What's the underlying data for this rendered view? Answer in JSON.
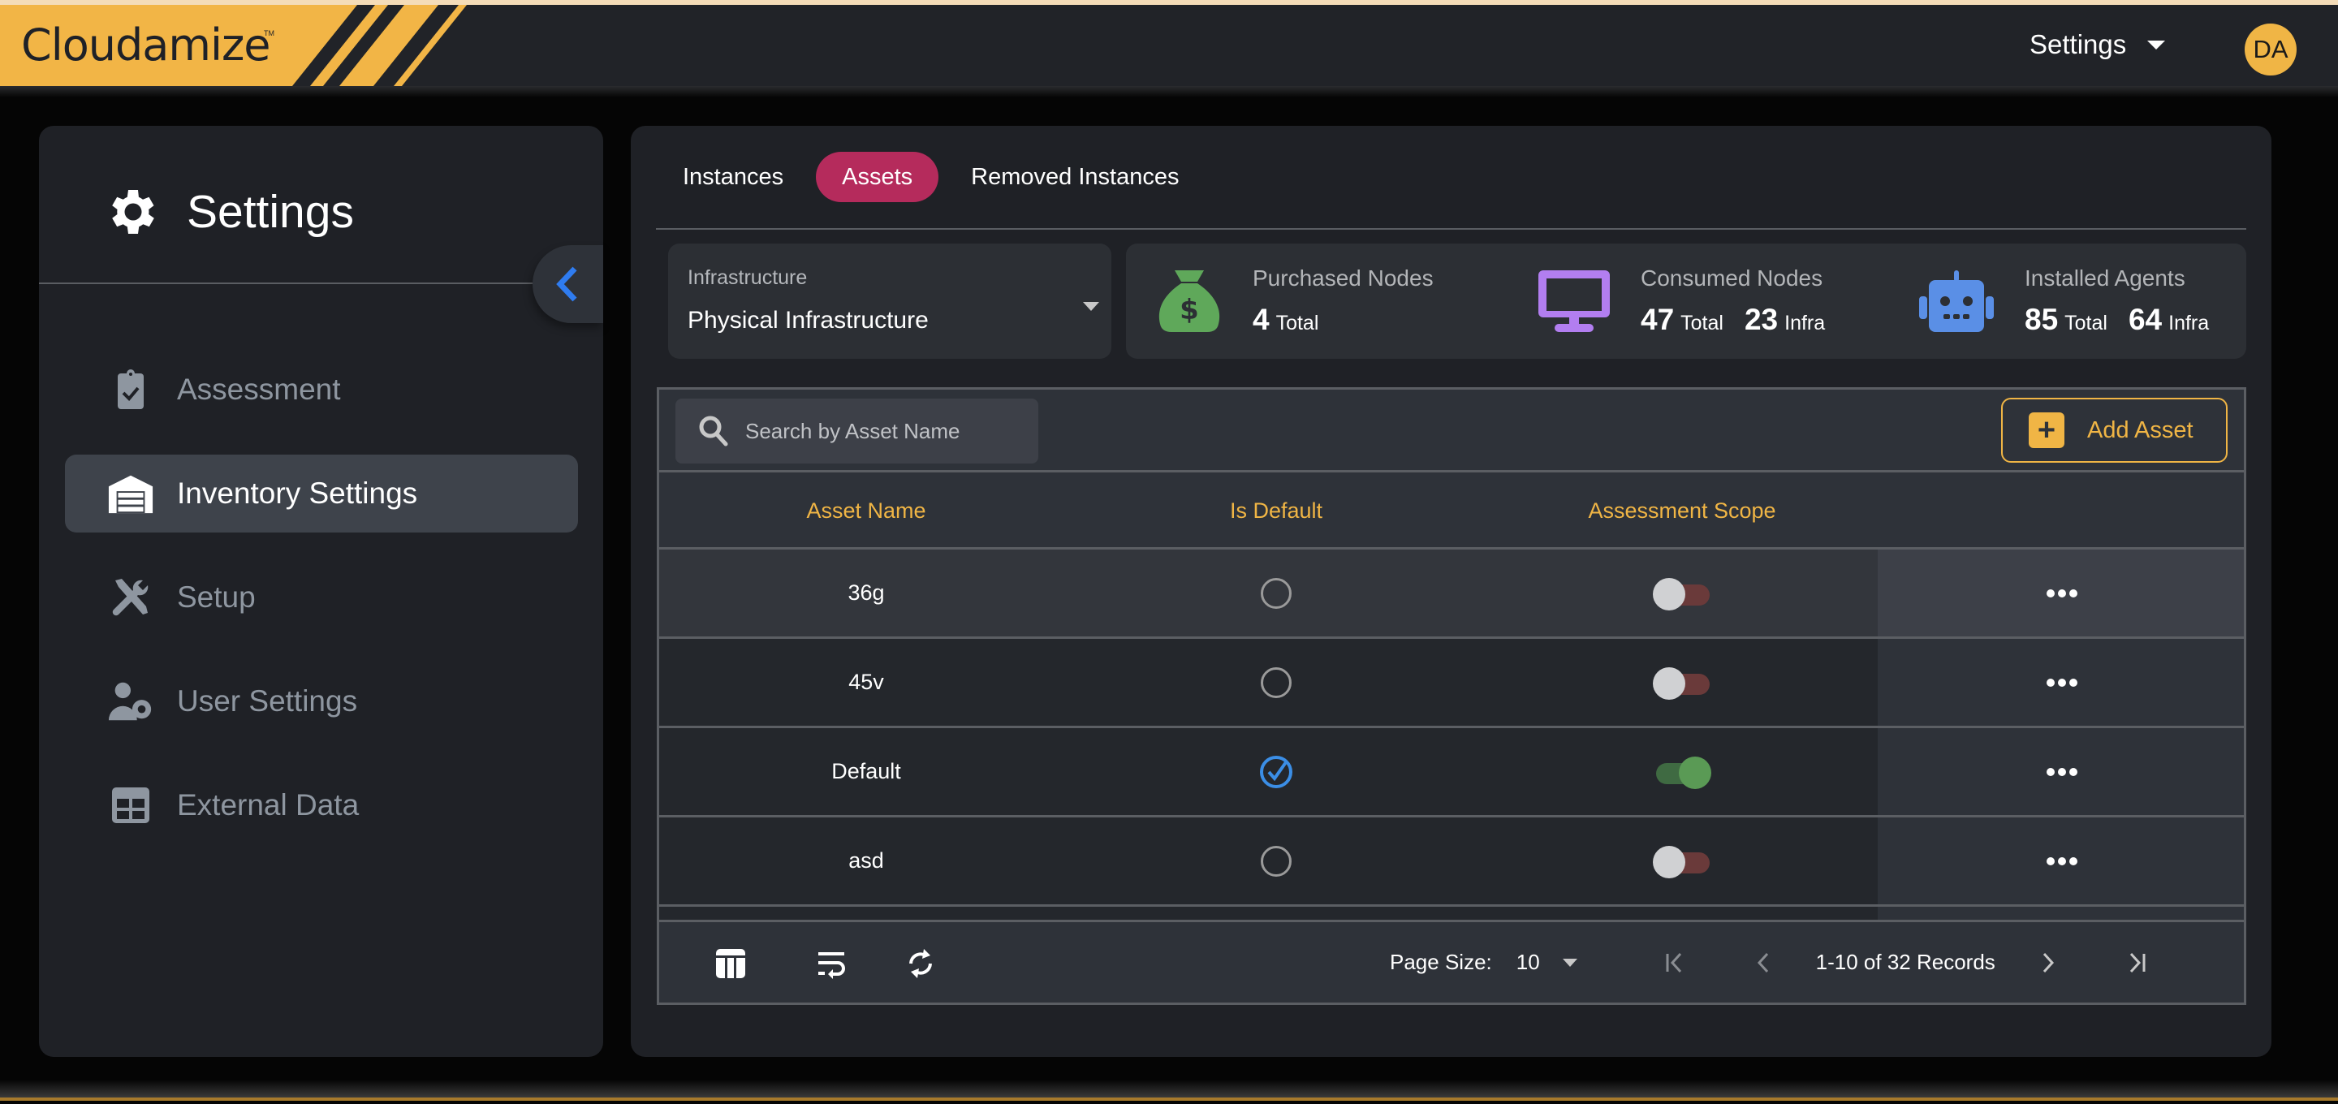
{
  "header": {
    "logo": "Cloudamize",
    "logo_tm": "TM",
    "settings_menu": "Settings",
    "avatar_initials": "DA",
    "brand_color": "#f0b545"
  },
  "sidebar": {
    "title": "Settings",
    "items": [
      {
        "label": "Assessment",
        "icon": "clipboard-check-icon",
        "active": false
      },
      {
        "label": "Inventory Settings",
        "icon": "warehouse-icon",
        "active": true
      },
      {
        "label": "Setup",
        "icon": "tools-icon",
        "active": false
      },
      {
        "label": "User Settings",
        "icon": "user-gear-icon",
        "active": false
      },
      {
        "label": "External Data",
        "icon": "table-icon",
        "active": false
      }
    ]
  },
  "main": {
    "tabs": [
      {
        "label": "Instances",
        "active": false
      },
      {
        "label": "Assets",
        "active": true
      },
      {
        "label": "Removed Instances",
        "active": false
      }
    ],
    "infrastructure": {
      "label": "Infrastructure",
      "value": "Physical Infrastructure"
    },
    "stats": [
      {
        "title": "Purchased Nodes",
        "icon": "money-bag-icon",
        "color": "#5fa85a",
        "values": [
          {
            "num": "4",
            "unit": "Total"
          }
        ]
      },
      {
        "title": "Consumed Nodes",
        "icon": "monitor-icon",
        "color": "#b27ef0",
        "values": [
          {
            "num": "47",
            "unit": "Total"
          },
          {
            "num": "23",
            "unit": "Infra"
          }
        ]
      },
      {
        "title": "Installed Agents",
        "icon": "robot-icon",
        "color": "#5a8fe6",
        "values": [
          {
            "num": "85",
            "unit": "Total"
          },
          {
            "num": "64",
            "unit": "Infra"
          }
        ]
      }
    ],
    "table": {
      "search_placeholder": "Search by Asset Name",
      "search_value": "",
      "add_button": "Add Asset",
      "columns": [
        "Asset Name",
        "Is Default",
        "Assessment Scope",
        ""
      ],
      "rows": [
        {
          "name": "36g",
          "is_default": false,
          "in_scope": false
        },
        {
          "name": "45v",
          "is_default": false,
          "in_scope": false
        },
        {
          "name": "Default",
          "is_default": true,
          "in_scope": true
        },
        {
          "name": "asd",
          "is_default": false,
          "in_scope": false
        }
      ],
      "footer": {
        "page_size_label": "Page Size:",
        "page_size": "10",
        "records": "1-10 of 32 Records"
      }
    }
  }
}
